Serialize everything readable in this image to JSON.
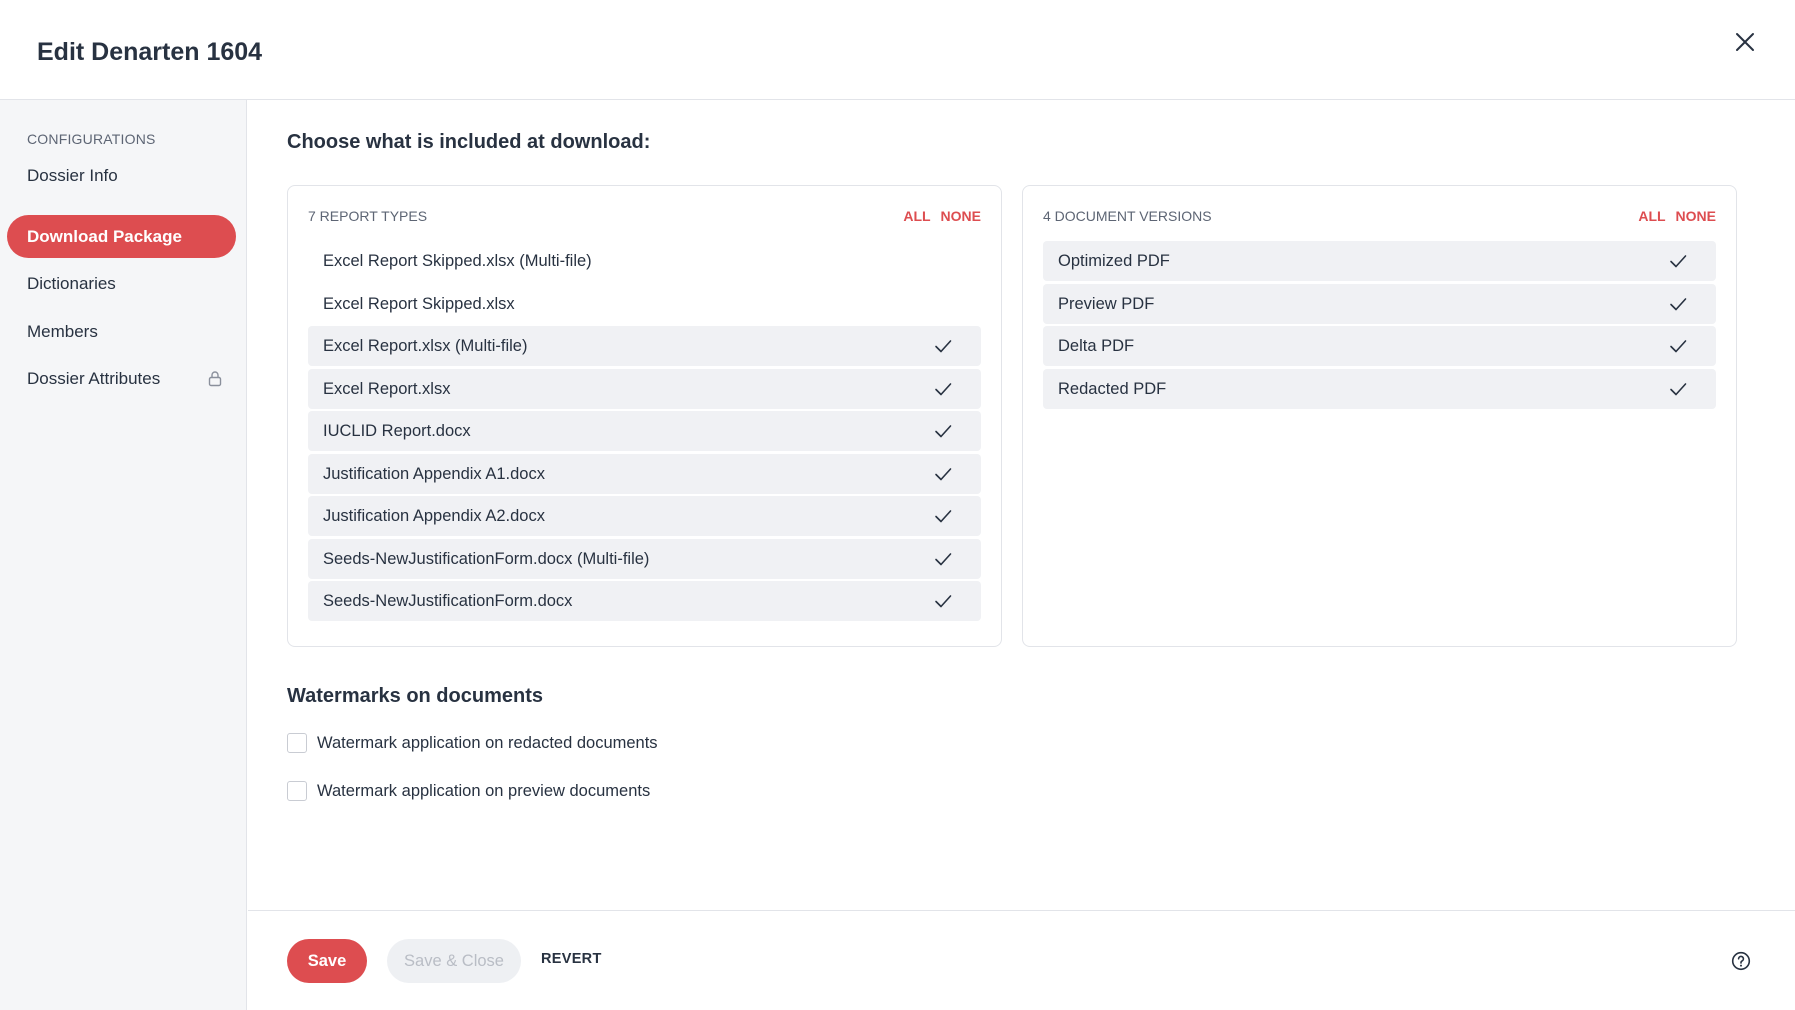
{
  "dialog": {
    "title": "Edit Denarten 1604"
  },
  "sidebar": {
    "heading": "CONFIGURATIONS",
    "items": [
      {
        "label": "Dossier Info",
        "active": false
      },
      {
        "label": "Download Package",
        "active": true
      },
      {
        "label": "Dictionaries",
        "active": false
      },
      {
        "label": "Members",
        "active": false
      },
      {
        "label": "Dossier Attributes",
        "active": false,
        "icon": "lock-icon"
      }
    ]
  },
  "main": {
    "section_title": "Choose what is included at download:",
    "report_types": {
      "heading": "7 REPORT TYPES",
      "all_label": "ALL",
      "none_label": "NONE",
      "items": [
        {
          "label": "Excel Report Skipped.xlsx (Multi-file)",
          "selected": false
        },
        {
          "label": "Excel Report Skipped.xlsx",
          "selected": false
        },
        {
          "label": "Excel Report.xlsx (Multi-file)",
          "selected": true
        },
        {
          "label": "Excel Report.xlsx",
          "selected": true
        },
        {
          "label": "IUCLID Report.docx",
          "selected": true
        },
        {
          "label": "Justification Appendix A1.docx",
          "selected": true
        },
        {
          "label": "Justification Appendix A2.docx",
          "selected": true
        },
        {
          "label": "Seeds-NewJustificationForm.docx (Multi-file)",
          "selected": true
        },
        {
          "label": "Seeds-NewJustificationForm.docx",
          "selected": true
        }
      ]
    },
    "document_versions": {
      "heading": "4 DOCUMENT VERSIONS",
      "all_label": "ALL",
      "none_label": "NONE",
      "items": [
        {
          "label": "Optimized PDF",
          "selected": true
        },
        {
          "label": "Preview PDF",
          "selected": true
        },
        {
          "label": "Delta PDF",
          "selected": true
        },
        {
          "label": "Redacted PDF",
          "selected": true
        }
      ]
    },
    "watermarks": {
      "title": "Watermarks on documents",
      "options": [
        {
          "label": "Watermark application on redacted documents",
          "checked": false
        },
        {
          "label": "Watermark application on preview documents",
          "checked": false
        }
      ]
    }
  },
  "footer": {
    "save_label": "Save",
    "save_close_label": "Save & Close",
    "revert_label": "REVERT"
  },
  "colors": {
    "accent": "#dd4d50",
    "text": "#283241",
    "muted": "#5d6574",
    "row_bg": "#f0f1f4"
  }
}
